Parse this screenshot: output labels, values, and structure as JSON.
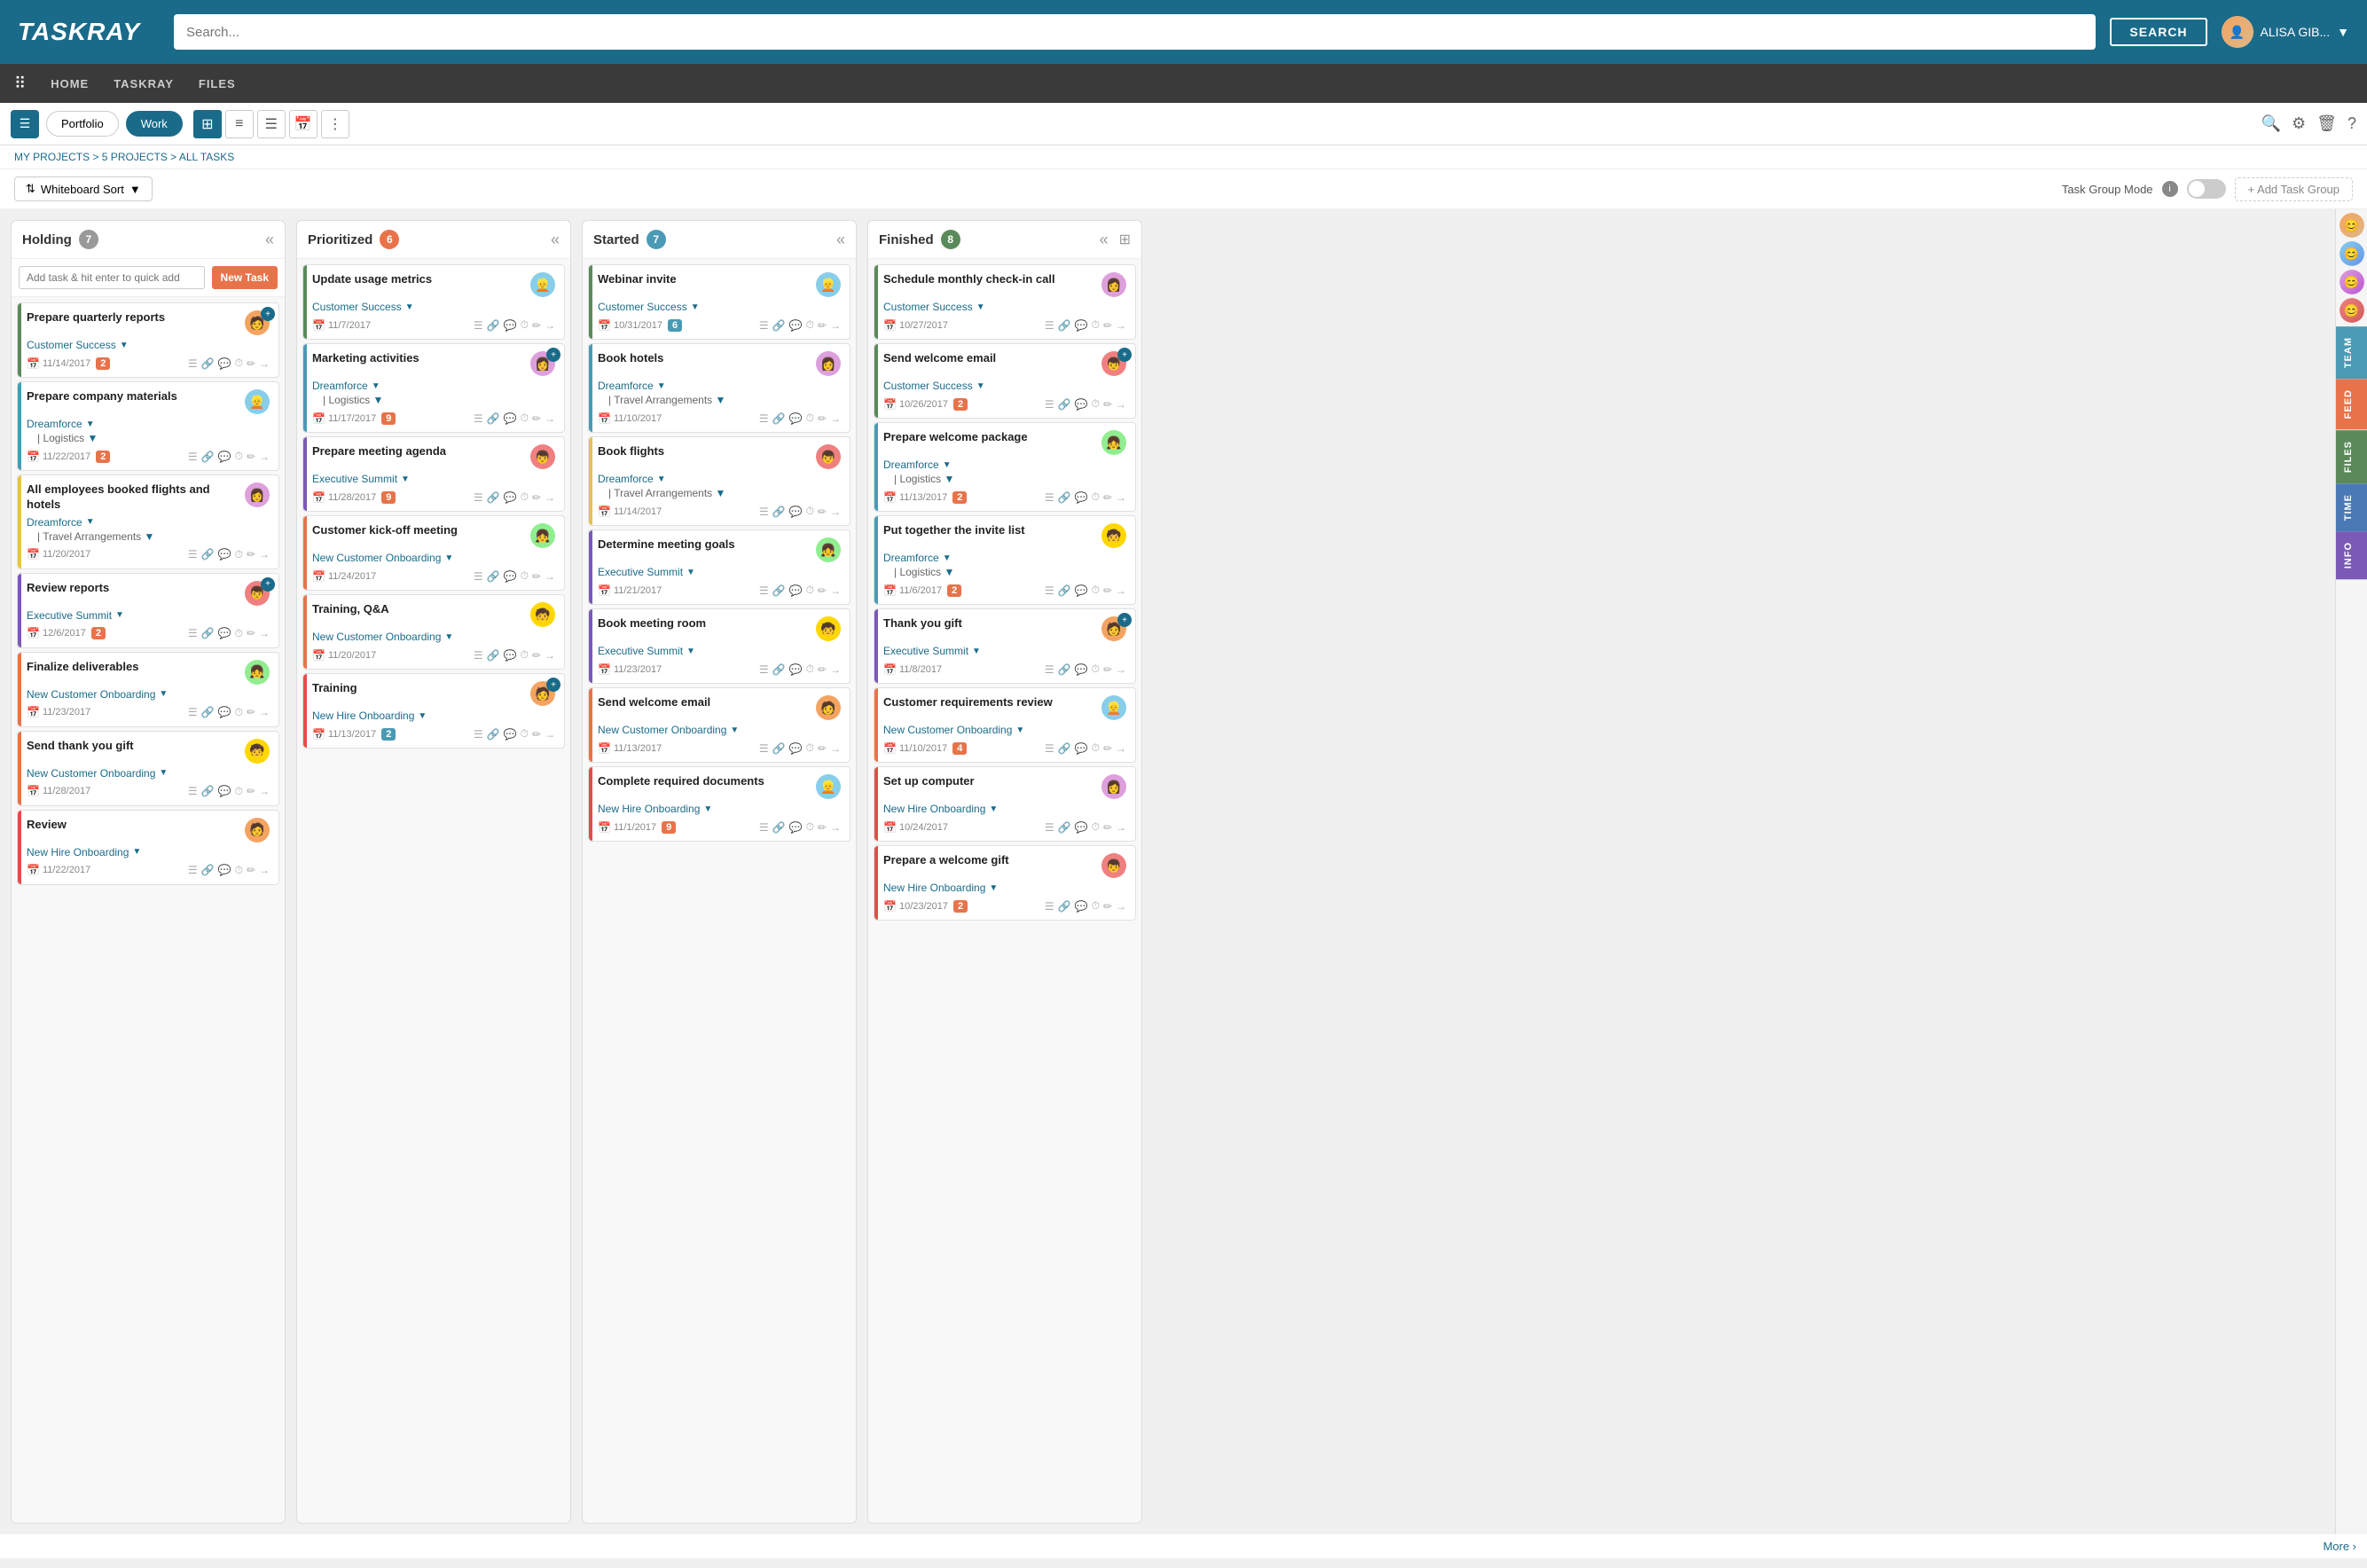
{
  "header": {
    "logo": "TASKRAY",
    "search_placeholder": "Search...",
    "search_btn": "SEARCH",
    "user_name": "ALISA GIB..."
  },
  "nav": {
    "items": [
      "HOME",
      "TASKRAY",
      "FILES"
    ]
  },
  "toolbar": {
    "tabs": [
      "Portfolio",
      "Work"
    ],
    "active_tab": "Work",
    "views": [
      "grid",
      "list",
      "rows",
      "calendar",
      "menu"
    ]
  },
  "breadcrumb": "MY PROJECTS > 5 PROJECTS > ALL TASKS",
  "sort_bar": {
    "sort_label": "Whiteboard Sort",
    "mode_label": "Task Group Mode",
    "add_group": "+ Add Task Group"
  },
  "right_sidebar": {
    "tabs": [
      "TEAM",
      "FEED",
      "FILES",
      "TIME",
      "INFO"
    ]
  },
  "columns": [
    {
      "id": "holding",
      "title": "Holding",
      "count": 7,
      "count_class": "holding",
      "quick_add_placeholder": "Add task & hit enter to quick add",
      "new_task_btn": "New Task",
      "tasks": [
        {
          "title": "Prepare quarterly reports",
          "group": "Customer Success",
          "group_color": "bar-green",
          "date": "11/14/2017",
          "avatar": "av1",
          "has_plus": true,
          "num": "2",
          "num_color": ""
        },
        {
          "title": "Prepare company materials",
          "group": "Dreamforce",
          "subgroup": "Logistics",
          "group_color": "bar-blue",
          "date": "11/22/2017",
          "avatar": "av2",
          "has_plus": false,
          "num": "2",
          "num_color": ""
        },
        {
          "title": "All employees booked flights and hotels",
          "group": "Dreamforce",
          "subgroup": "Travel Arrangements",
          "group_color": "bar-yellow",
          "date": "11/20/2017",
          "avatar": "av3",
          "has_plus": false,
          "num": "",
          "num_color": ""
        },
        {
          "title": "Review reports",
          "group": "Executive Summit",
          "group_color": "bar-purple",
          "date": "12/6/2017",
          "avatar": "av4",
          "has_plus": true,
          "num": "2",
          "num_color": ""
        },
        {
          "title": "Finalize deliverables",
          "group": "New Customer Onboarding",
          "group_color": "bar-orange",
          "date": "11/23/2017",
          "avatar": "av5",
          "has_plus": false,
          "num": "",
          "num_color": ""
        },
        {
          "title": "Send thank you gift",
          "group": "New Customer Onboarding",
          "group_color": "bar-orange",
          "date": "11/28/2017",
          "avatar": "av6",
          "has_plus": false,
          "num": "",
          "num_color": ""
        },
        {
          "title": "Review",
          "group": "New Hire Onboarding",
          "group_color": "bar-red",
          "date": "11/22/2017",
          "avatar": "av1",
          "has_plus": false,
          "num": "",
          "num_color": ""
        }
      ]
    },
    {
      "id": "prioritized",
      "title": "Prioritized",
      "count": 6,
      "count_class": "prioritized",
      "tasks": [
        {
          "title": "Update usage metrics",
          "group": "Customer Success",
          "group_color": "bar-green",
          "date": "11/7/2017",
          "avatar": "av2",
          "has_plus": false,
          "num": "",
          "num_color": ""
        },
        {
          "title": "Marketing activities",
          "group": "Dreamforce",
          "subgroup": "Logistics",
          "group_color": "bar-blue",
          "date": "11/17/2017",
          "avatar": "av3",
          "has_plus": true,
          "num": "9",
          "num_color": ""
        },
        {
          "title": "Prepare meeting agenda",
          "group": "Executive Summit",
          "group_color": "bar-purple",
          "date": "11/28/2017",
          "avatar": "av4",
          "has_plus": false,
          "num": "9",
          "num_color": ""
        },
        {
          "title": "Customer kick-off meeting",
          "group": "New Customer Onboarding",
          "group_color": "bar-orange",
          "date": "11/24/2017",
          "avatar": "av5",
          "has_plus": false,
          "num": "",
          "num_color": ""
        },
        {
          "title": "Training, Q&A",
          "group": "New Customer Onboarding",
          "group_color": "bar-orange",
          "date": "11/20/2017",
          "avatar": "av6",
          "has_plus": false,
          "num": "",
          "num_color": ""
        },
        {
          "title": "Training",
          "group": "New Hire Onboarding",
          "group_color": "bar-red",
          "date": "11/13/2017",
          "avatar": "av1",
          "has_plus": true,
          "num": "2",
          "num_color": "blue"
        }
      ]
    },
    {
      "id": "started",
      "title": "Started",
      "count": 7,
      "count_class": "started",
      "tasks": [
        {
          "title": "Webinar invite",
          "group": "Customer Success",
          "group_color": "bar-green",
          "date": "10/31/2017",
          "avatar": "av2",
          "has_plus": false,
          "num": "6",
          "num_color": "blue"
        },
        {
          "title": "Book hotels",
          "group": "Dreamforce",
          "subgroup": "Travel Arrangements",
          "group_color": "bar-blue",
          "date": "11/10/2017",
          "avatar": "av3",
          "has_plus": false,
          "num": "",
          "num_color": ""
        },
        {
          "title": "Book flights",
          "group": "Dreamforce",
          "subgroup": "Travel Arrangements",
          "group_color": "bar-yellow",
          "date": "11/14/2017",
          "avatar": "av4",
          "has_plus": false,
          "num": "",
          "num_color": ""
        },
        {
          "title": "Determine meeting goals",
          "group": "Executive Summit",
          "group_color": "bar-purple",
          "date": "11/21/2017",
          "avatar": "av5",
          "has_plus": false,
          "num": "",
          "num_color": ""
        },
        {
          "title": "Book meeting room",
          "group": "Executive Summit",
          "group_color": "bar-purple",
          "date": "11/23/2017",
          "avatar": "av6",
          "has_plus": false,
          "num": "",
          "num_color": ""
        },
        {
          "title": "Send welcome email",
          "group": "New Customer Onboarding",
          "group_color": "bar-orange",
          "date": "11/13/2017",
          "avatar": "av1",
          "has_plus": false,
          "num": "",
          "num_color": ""
        },
        {
          "title": "Complete required documents",
          "group": "New Hire Onboarding",
          "group_color": "bar-red",
          "date": "11/1/2017",
          "avatar": "av2",
          "has_plus": false,
          "num": "9",
          "num_color": ""
        }
      ]
    },
    {
      "id": "finished",
      "title": "Finished",
      "count": 8,
      "count_class": "finished",
      "tasks": [
        {
          "title": "Schedule monthly check-in call",
          "group": "Customer Success",
          "group_color": "bar-green",
          "date": "10/27/2017",
          "avatar": "av3",
          "has_plus": false,
          "num": "",
          "num_color": ""
        },
        {
          "title": "Send welcome email",
          "group": "Customer Success",
          "group_color": "bar-green",
          "date": "10/26/2017",
          "avatar": "av4",
          "has_plus": true,
          "num": "2",
          "num_color": ""
        },
        {
          "title": "Prepare welcome package",
          "group": "Dreamforce",
          "subgroup": "Logistics",
          "group_color": "bar-blue",
          "date": "11/13/2017",
          "avatar": "av5",
          "has_plus": false,
          "num": "2",
          "num_color": ""
        },
        {
          "title": "Put together the invite list",
          "group": "Dreamforce",
          "subgroup": "Logistics",
          "group_color": "bar-blue",
          "date": "11/6/2017",
          "avatar": "av6",
          "has_plus": false,
          "num": "2",
          "num_color": ""
        },
        {
          "title": "Thank you gift",
          "group": "Executive Summit",
          "group_color": "bar-purple",
          "date": "11/8/2017",
          "avatar": "av1",
          "has_plus": true,
          "num": "",
          "num_color": ""
        },
        {
          "title": "Customer requirements review",
          "group": "New Customer Onboarding",
          "group_color": "bar-orange",
          "date": "11/10/2017",
          "avatar": "av2",
          "has_plus": false,
          "num": "4",
          "num_color": ""
        },
        {
          "title": "Set up computer",
          "group": "New Hire Onboarding",
          "group_color": "bar-red",
          "date": "10/24/2017",
          "avatar": "av3",
          "has_plus": false,
          "num": "",
          "num_color": ""
        },
        {
          "title": "Prepare a welcome gift",
          "group": "New Hire Onboarding",
          "group_color": "bar-red",
          "date": "10/23/2017",
          "avatar": "av4",
          "has_plus": false,
          "num": "2",
          "num_color": ""
        }
      ]
    }
  ]
}
